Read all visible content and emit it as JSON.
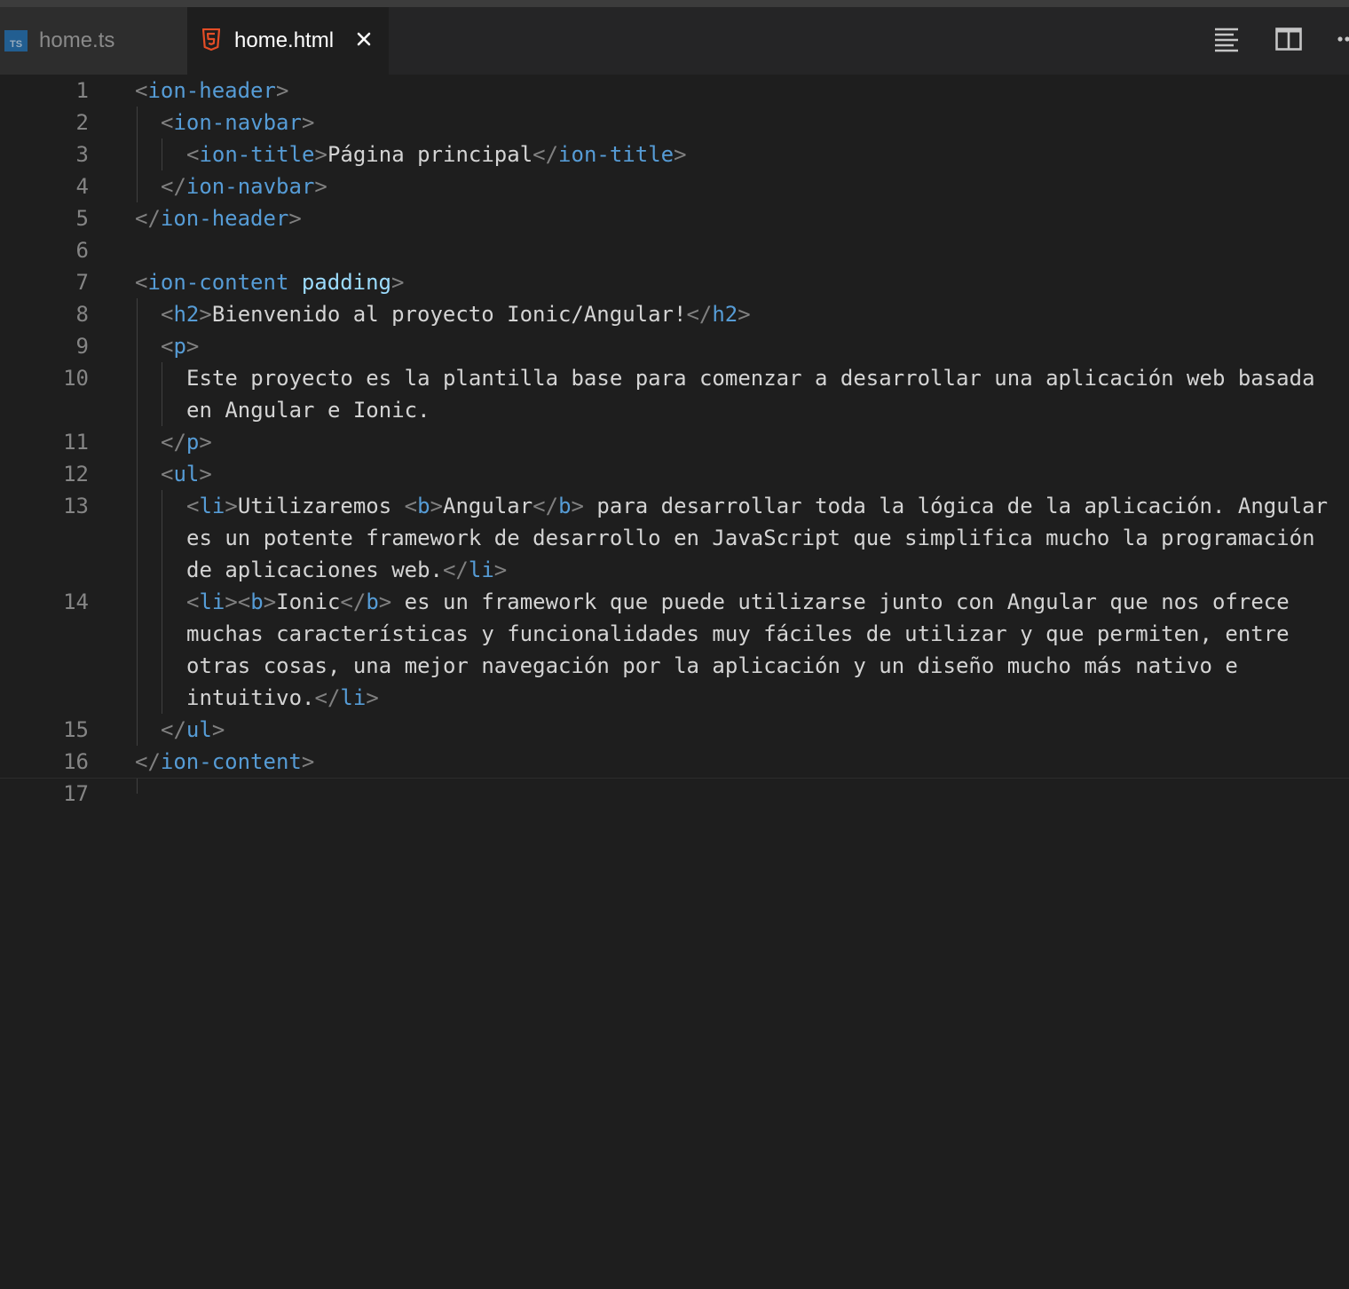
{
  "tabs": [
    {
      "label": "home.ts",
      "icon": "typescript-icon",
      "icon_text": "TS",
      "active": false
    },
    {
      "label": "home.html",
      "icon": "html5-icon",
      "active": true
    }
  ],
  "colors": {
    "tag": "#569cd6",
    "punctuation": "#808080",
    "attribute": "#9cdcfe",
    "text": "#d4d4d4",
    "line_number": "#858585",
    "html5_icon": "#e44d26",
    "background": "#1e1e1e"
  },
  "line_numbers": [
    "1",
    "2",
    "3",
    "4",
    "5",
    "6",
    "7",
    "8",
    "9",
    "10",
    "11",
    "12",
    "13",
    "14",
    "15",
    "16",
    "17"
  ],
  "code": {
    "l1_tag": "ion-header",
    "l2_tag": "ion-navbar",
    "l3_tag": "ion-title",
    "l3_text": "Página principal",
    "l4_tag": "ion-navbar",
    "l5_tag": "ion-header",
    "l7_tag": "ion-content",
    "l7_attr": "padding",
    "l8_tag": "h2",
    "l8_text": "Bienvenido al proyecto Ionic/Angular!",
    "l9_tag": "p",
    "l10_text_a": "Este proyecto es la plantilla base para comenzar a desarrollar una aplicación web basada",
    "l10_text_b": "en Angular e Ionic.",
    "l11_tag": "p",
    "l12_tag": "ul",
    "l13_li": "li",
    "l13_text_a": "Utilizaremos ",
    "l13_b": "b",
    "l13_bold": "Angular",
    "l13_text_b": " para desarrollar toda la lógica de la aplicación. Angular",
    "l13_text_c": "es un potente framework de desarrollo en JavaScript que simplifica mucho la programación",
    "l13_text_d": "de aplicaciones web.",
    "l14_li": "li",
    "l14_b": "b",
    "l14_bold": "Ionic",
    "l14_text_a": " es un framework que puede utilizarse junto con Angular que nos ofrece",
    "l14_text_b": "muchas características y funcionalidades muy fáciles de utilizar y que permiten, entre",
    "l14_text_c": "otras cosas, una mejor navegación por la aplicación y un diseño mucho más nativo e",
    "l14_text_d": "intuitivo.",
    "l15_tag": "ul",
    "l16_tag": "ion-content"
  }
}
